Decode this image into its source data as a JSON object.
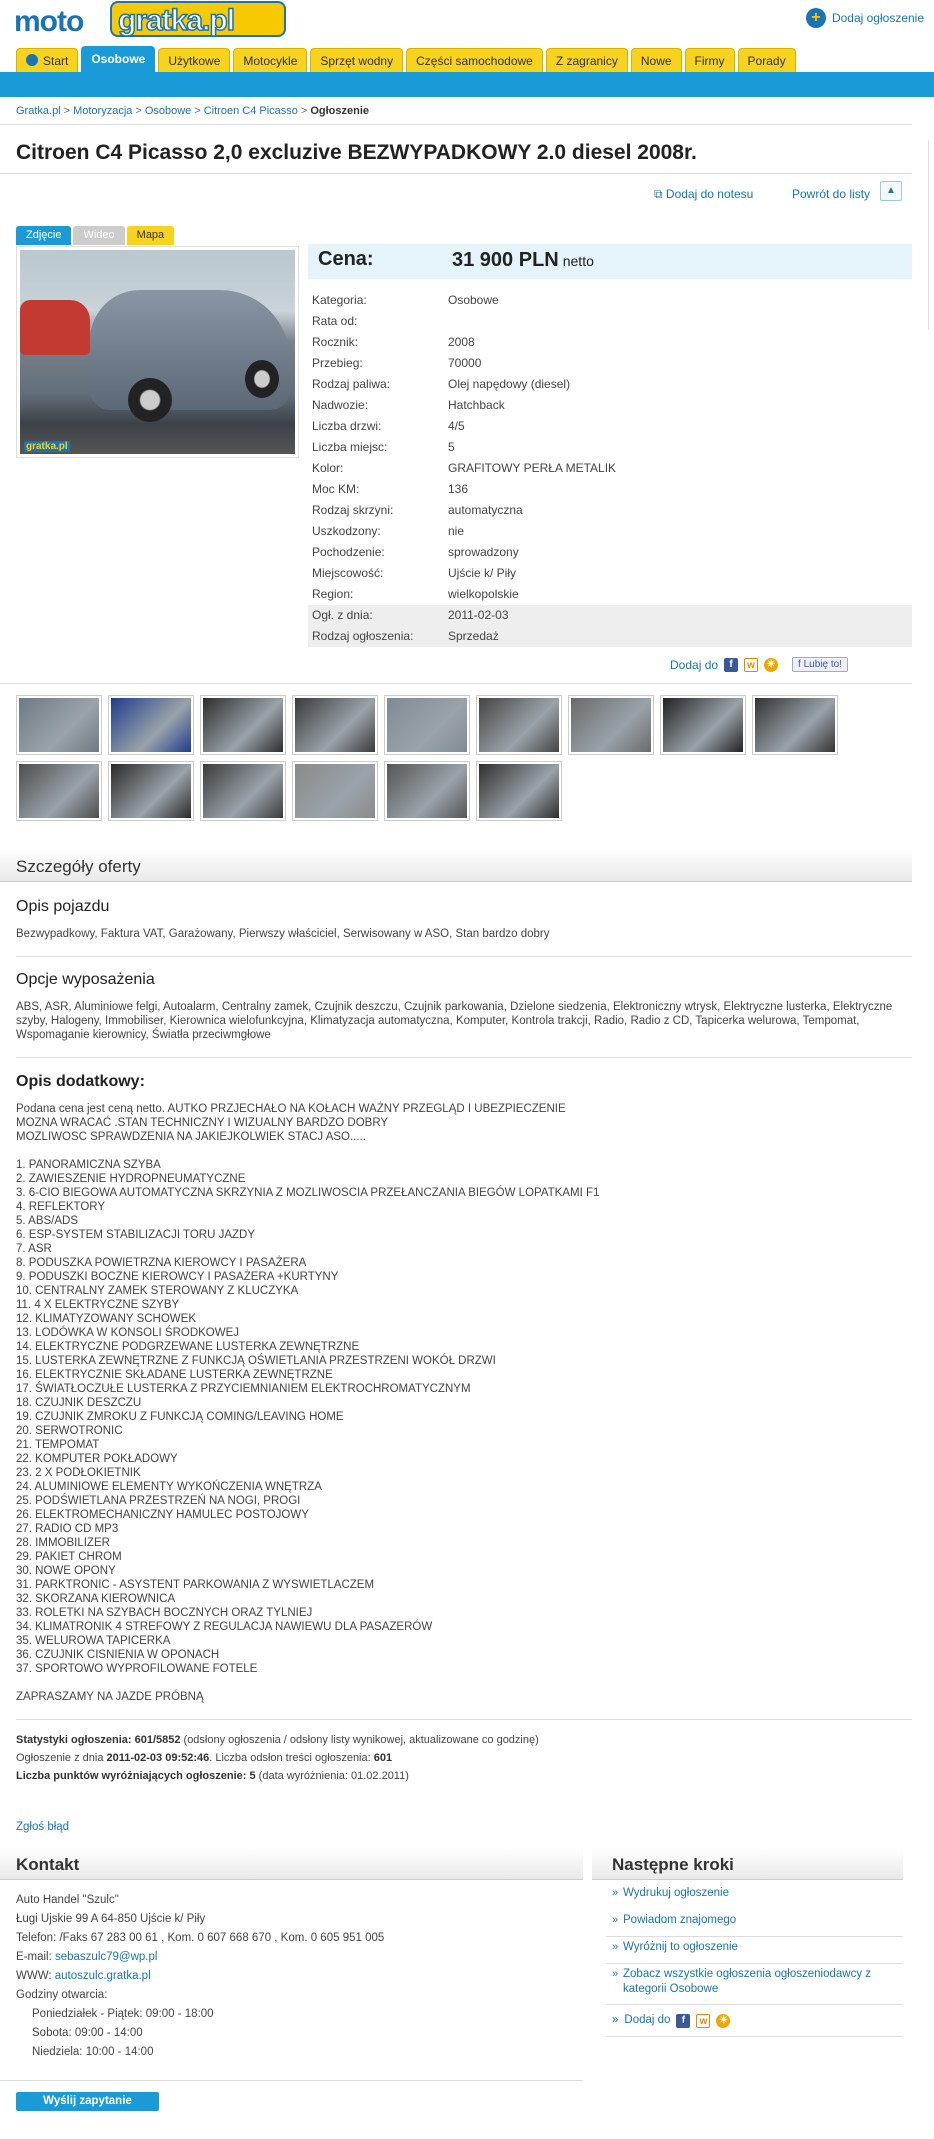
{
  "logo": {
    "part1": "moto",
    "part2": "gratka.pl"
  },
  "header": {
    "add_ad": "Dodaj ogłoszenie"
  },
  "nav": [
    "Start",
    "Osobowe",
    "Użytkowe",
    "Motocykle",
    "Sprzęt wodny",
    "Części samochodowe",
    "Z zagranicy",
    "Nowe",
    "Firmy",
    "Porady"
  ],
  "nav_active": "Osobowe",
  "breadcrumb": {
    "items": [
      "Gratka.pl",
      "Motoryzacja",
      "Osobowe",
      "Citroen C4 Picasso"
    ],
    "current": "Ogłoszenie",
    "sep": ">"
  },
  "title": "Citroen C4 Picasso 2,0 excluzive BEZWYPADKOWY 2.0 diesel 2008r.",
  "actions": {
    "notes": "Dodaj do notesu",
    "back": "Powrót do listy",
    "up": "▲"
  },
  "media_tabs": [
    "Zdjęcie",
    "Wideo",
    "Mapa"
  ],
  "photo_watermark": "gratka.pl",
  "price": {
    "label": "Cena:",
    "value": "31 900 PLN",
    "suffix": "netto"
  },
  "specs": [
    {
      "k": "Kategoria:",
      "v": "Osobowe"
    },
    {
      "k": "Rata od:",
      "v": ""
    },
    {
      "k": "Rocznik:",
      "v": "2008"
    },
    {
      "k": "Przebieg:",
      "v": "70000"
    },
    {
      "k": "Rodzaj paliwa:",
      "v": "Olej napędowy (diesel)"
    },
    {
      "k": "Nadwozie:",
      "v": "Hatchback"
    },
    {
      "k": "Liczba drzwi:",
      "v": "4/5"
    },
    {
      "k": "Liczba miejsc:",
      "v": "5"
    },
    {
      "k": "Kolor:",
      "v": "GRAFITOWY PERŁA METALIK"
    },
    {
      "k": "Moc KM:",
      "v": "136"
    },
    {
      "k": "Rodzaj skrzyni:",
      "v": "automatyczna"
    },
    {
      "k": "Uszkodzony:",
      "v": "nie"
    },
    {
      "k": "Pochodzenie:",
      "v": "sprowadzony"
    },
    {
      "k": "Miejscowość:",
      "v": "Ujście k/ Piły"
    },
    {
      "k": "Region:",
      "v": "wielkopolskie"
    },
    {
      "k": "Ogł. z dnia:",
      "v": "2011-02-03"
    },
    {
      "k": "Rodzaj ogłoszenia:",
      "v": "Sprzedaż"
    }
  ],
  "share": {
    "label": "Dodaj do",
    "like": "Lubię to!"
  },
  "thumb_colors": [
    "#6d7a84",
    "#1f3c8a",
    "#2d2d2d",
    "#3a3a3a",
    "#7f8b95",
    "#444",
    "#6a6a6a",
    "#222",
    "#333",
    "#4d4d4d",
    "#2a2a2a",
    "#3b3b3b",
    "#8a8a8a",
    "#555",
    "#2e2e2e"
  ],
  "details": {
    "heading": "Szczegóły oferty",
    "opis_h": "Opis pojazdu",
    "opis_t": "Bezwypadkowy, Faktura VAT, Garażowany, Pierwszy właściciel, Serwisowany w ASO, Stan bardzo dobry",
    "opcje_h": "Opcje wyposażenia",
    "opcje_t": "ABS, ASR, Aluminiowe felgi, Autoalarm, Centralny zamek, Czujnik deszczu, Czujnik parkowania, Dzielone siedzenia, Elektroniczny wtrysk, Elektryczne lusterka, Elektryczne szyby, Halogeny, Immobiliser, Kierownica wielofunkcyjna, Klimatyzacja automatyczna, Komputer, Kontrola trakcji, Radio, Radio z CD, Tapicerka welurowa, Tempomat, Wspomaganie kierownicy, Światła przeciwmgłowe",
    "dodatkowe_h": "Opis dodatkowy:",
    "dodatkowe_t": "Podana cena jest ceną netto. AUTKO PRZJECHAŁO NA KOŁACH WAŻNY PRZEGLĄD I UBEZPIECZENIE\nMOZNA WRACAĆ .STAN TECHNICZNY I WIZUALNY BARDZO DOBRY\nMOZLIWOSC SPRAWDZENIA NA JAKIEJKOLWIEK STACJ ASO.....\n\n1. PANORAMICZNA SZYBA\n2. ZAWIESZENIE HYDROPNEUMATYCZNE\n3. 6-CIO BIEGOWA AUTOMATYCZNA SKRZYNIA Z MOZLIWOSCIA PRZEŁANCZANIA BIEGÓW LOPATKAMI F1\n4. REFLEKTORY\n5. ABS/ADS\n6. ESP-SYSTEM STABILIZACJI TORU JAZDY\n7. ASR\n8. PODUSZKA POWIETRZNA KIEROWCY I PASAŻERA\n9. PODUSZKI BOCZNE KIEROWCY I PASAŻERA +KURTYNY\n10. CENTRALNY ZAMEK STEROWANY Z KLUCZYKA\n11. 4 X ELEKTRYCZNE SZYBY\n12. KLIMATYZOWANY SCHOWEK\n13. LODÓWKA W KONSOLI ŚRODKOWEJ\n14. ELEKTRYCZNE PODGRZEWANE LUSTERKA ZEWNĘTRZNE\n15. LUSTERKA ZEWNĘTRZNE Z FUNKCJĄ OŚWIETLANIA PRZESTRZENI WOKÓŁ DRZWI\n16. ELEKTRYCZNIE SKŁADANE LUSTERKA ZEWNĘTRZNE\n17. ŚWIATŁOCZUŁE LUSTERKA Z PRZYCIEMNIANIEM ELEKTROCHROMATYCZNYM\n18. CZUJNIK DESZCZU\n19. CZUJNIK ZMROKU Z FUNKCJĄ COMING/LEAVING HOME\n20. SERWOTRONIC\n21. TEMPOMAT\n22. KOMPUTER POKŁADOWY\n23. 2 X PODŁOKIETNIK\n24. ALUMINIOWE ELEMENTY WYKOŃCZENIA WNĘTRZA\n25. PODŚWIETLANA PRZESTRZEŃ NA NOGI, PROGI\n26. ELEKTROMECHANICZNY HAMULEC POSTOJOWY\n27. RADIO CD MP3\n28. IMMOBILIZER\n29. PAKIET CHROM\n30. NOWE OPONY\n31. PARKTRONIC - ASYSTENT PARKOWANIA Z WYSWIETLACZEM\n32. SKORZANA KIEROWNICA\n33. ROLETKI NA SZYBACH BOCZNYCH ORAZ TYLNIEJ\n34. KLIMATRONIK 4 STREFOWY Z REGULACJA NAWIEWU DLA PASAZERÓW\n35. WELUROWA TAPICERKA\n36. CZUJNIK CISNIENIA W OPONACH\n37. SPORTOWO WYPROFILOWANE FOTELE\n\nZAPRASZAMY NA JAZDE PRÓBNĄ"
  },
  "stats": {
    "l1_b": "Statystyki ogłoszenia: 601/5852",
    "l1_t": " (odsłony ogłoszenia / odsłony listy wynikowej, aktualizowane co godzinę)",
    "l2_a": "Ogłoszenie z dnia ",
    "l2_b": "2011-02-03 09:52:46",
    "l2_c": ". Liczba odsłon treści ogłoszenia: ",
    "l2_d": "601",
    "l3_b": "Liczba punktów wyróżniających ogłoszenie: 5",
    "l3_t": " (data wyróżnienia: 01.02.2011)"
  },
  "report": "Zgłoś błąd",
  "kontakt": {
    "heading": "Kontakt",
    "name": "Auto Handel \"Szulc\"",
    "address": "Ługi Ujskie 99 A 64-850 Ujście k/ Piły",
    "phone": "Telefon: /Faks 67 283 00 61 , Kom. 0 607 668 670 , Kom. 0 605 951 005",
    "email_lbl": "E-mail: ",
    "email": "sebaszulc79@wp.pl",
    "www_lbl": "WWW: ",
    "www": "autoszulc.gratka.pl",
    "hours_h": "Godziny otwarcia:",
    "hours": [
      "Poniedziałek - Piątek: 09:00 - 18:00",
      "Sobota: 09:00 - 14:00",
      "Niedziela: 10:00 - 14:00"
    ],
    "send": "Wyślij zapytanie"
  },
  "kroki": {
    "heading": "Następne kroki",
    "items": [
      "Wydrukuj ogłoszenie",
      "Powiadom znajomego",
      "Wyróżnij to ogłoszenie",
      "Zobacz wszystkie ogłoszenia ogłoszeniodawcy z kategorii Osobowe"
    ],
    "share": "Dodaj do"
  }
}
